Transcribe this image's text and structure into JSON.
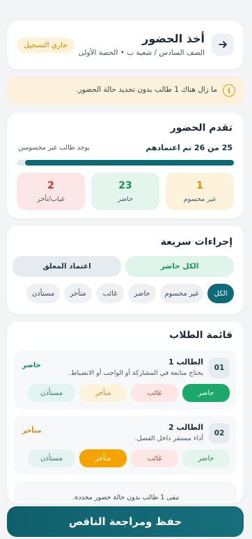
{
  "header": {
    "title": "أخذ الحضور",
    "subtitle": "الصف السادس / شعبة ب • الحصة الأولى",
    "status_badge": "جاري التسجيل"
  },
  "warning": {
    "icon": "info-icon",
    "text": "ما زال هناك 1 طالب بدون تحديد حالة الحضور."
  },
  "progress": {
    "title": "تقدم الحضور",
    "summary": "25 من 26 تم اعتمادهم",
    "unmarked_note": "يوجد طالب غير محسومين",
    "fraction": 0.96,
    "stats": [
      {
        "value": "1",
        "label": "غير محسوم"
      },
      {
        "value": "23",
        "label": "حاضر"
      },
      {
        "value": "2",
        "label": "غياب/تأخر"
      }
    ]
  },
  "quick_actions": {
    "title": "إجراءات سريعة",
    "all_present": "الكل حاضر",
    "approve_pending": "اعتماد المعلق",
    "filters": [
      "الكل",
      "غير محسوم",
      "حاضر",
      "غائب",
      "متأخر",
      "مستأذن"
    ],
    "active_filter": "الكل"
  },
  "students": {
    "title": "قائمة الطلاب",
    "options": [
      "حاضر",
      "غائب",
      "متأخر",
      "مستأذن"
    ],
    "items": [
      {
        "number": "01",
        "name": "الطالب 1",
        "note": "يحتاج متابعة في المشاركة أو الواجب أو الانضباط.",
        "state": "حاضر",
        "selected": "حاضر"
      },
      {
        "number": "02",
        "name": "الطالب 2",
        "note": "أداء مستقر داخل الفصل.",
        "state": "متأخر",
        "selected": "متأخر"
      }
    ]
  },
  "footer": {
    "remaining": "تبقى 1 طالب بدون حالة حضور محددة.",
    "save_label": "حفظ ومراجعة الناقص"
  },
  "colors": {
    "primary": "#0f6a78",
    "present": "#1ca86a",
    "absent": "#d3302f",
    "late": "#f5a300",
    "warning_bg": "#fbf1dc"
  }
}
